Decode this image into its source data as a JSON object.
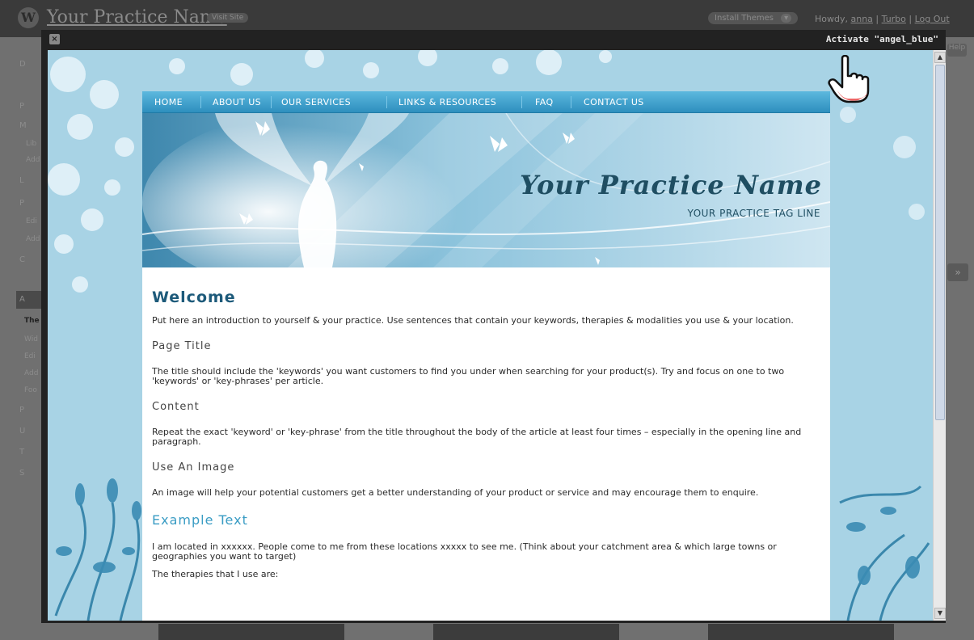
{
  "wp_admin": {
    "logo": "W",
    "site_name": "Your Practice Name",
    "visit_site": "Visit Site",
    "install_themes": "Install Themes",
    "howdy_prefix": "Howdy,",
    "user": "anna",
    "turbo": "Turbo",
    "log_out": "Log Out",
    "help": "Help",
    "sidebar": [
      "D",
      "P",
      "M",
      "Lib",
      "Add",
      "L",
      "P",
      "Edi",
      "Add",
      "C",
      "A",
      "The",
      "Wid",
      "Edi",
      "Add",
      "Foo",
      "P",
      "U",
      "T",
      "S"
    ]
  },
  "modal": {
    "close_glyph": "×",
    "activate_label": "Activate \"angel_blue\""
  },
  "site": {
    "nav": [
      "HOME",
      "ABOUT US",
      "OUR SERVICES",
      "LINKS & RESOURCES",
      "FAQ",
      "CONTACT US"
    ],
    "banner_title": "Your Practice Name",
    "banner_tagline": "YOUR PRACTICE TAG LINE",
    "content": {
      "welcome": "Welcome",
      "intro": "Put here an introduction to yourself & your practice. Use sentences that contain your keywords, therapies & modalities you use & your location.",
      "page_title_h": "Page Title",
      "page_title_p": "The title should include the 'keywords' you want customers to find you under when searching for your product(s). Try and focus on one to two 'keywords' or 'key-phrases' per article.",
      "content_h": "Content",
      "content_p": "Repeat the exact 'keyword' or 'key-phrase' from the title throughout the body of the article at least four times – especially in the opening line and paragraph.",
      "image_h": "Use An Image",
      "image_p": "An image will help your potential customers get a better understanding of your product or service and may encourage them to enquire.",
      "example_h": "Example Text",
      "example_p": "I am located in xxxxxx. People come to me from these locations xxxxx to see me. (Think about your catchment area & which large towns or geographies you want to target)",
      "therapies_p": "The therapies that I use are:"
    }
  },
  "colors": {
    "nav_blue": "#2e8fbe",
    "heading_blue": "#1d5a7a",
    "example_blue": "#3a9cc4",
    "theme_bg": "#a6d2e4"
  }
}
